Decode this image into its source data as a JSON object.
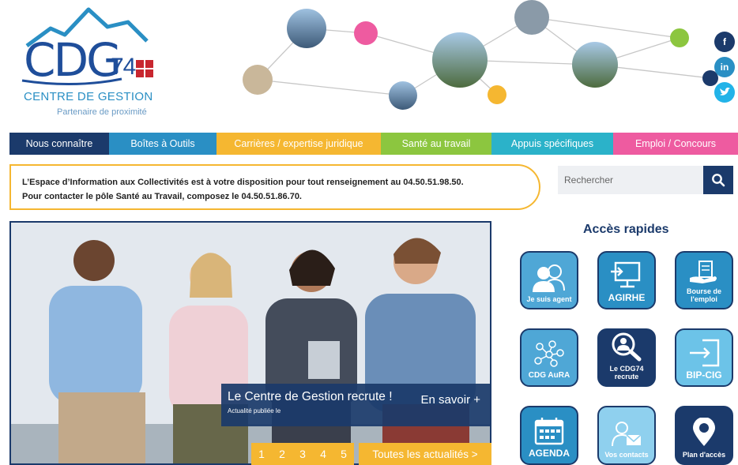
{
  "logo": {
    "main": "CDG",
    "number": "74",
    "subtitle": "CENTRE DE GESTION",
    "tagline": "Partenaire de proximité"
  },
  "social": [
    {
      "name": "facebook",
      "glyph": "f",
      "color": "#1b3a6b"
    },
    {
      "name": "linkedin",
      "glyph": "in",
      "color": "#2a8fc4"
    },
    {
      "name": "twitter",
      "glyph": "t",
      "color": "#22b3e8"
    }
  ],
  "nav": [
    {
      "label": "Nous connaître",
      "color": "#1b3a6b"
    },
    {
      "label": "Boîtes à Outils",
      "color": "#2a8fc4"
    },
    {
      "label": "Carrières / expertise juridique",
      "color": "#f5b731"
    },
    {
      "label": "Santé au travail",
      "color": "#8cc63f"
    },
    {
      "label": "Appuis spécifiques",
      "color": "#2bb2c9"
    },
    {
      "label": "Emploi / Concours",
      "color": "#ee5ba0"
    }
  ],
  "info": {
    "line1": "L’Espace d’Information aux Collectivités est à votre disposition pour tout renseignement au 04.50.51.98.50.",
    "line2": "Pour contacter le pôle Santé au Travail, composez le 04.50.51.86.70."
  },
  "search": {
    "placeholder": "Rechercher"
  },
  "hero": {
    "title": "Le Centre de Gestion recrute !",
    "more": "En savoir +",
    "meta": "Actualité publiée le",
    "pages": [
      "1",
      "2",
      "3",
      "4",
      "5"
    ],
    "all_news": "Toutes les actualités >"
  },
  "quick_access": {
    "title": "Accès rapides",
    "tiles": [
      {
        "label": "Je suis agent",
        "icon": "users-icon",
        "color": "#4fa7d6"
      },
      {
        "label": "AGIRHE",
        "icon": "computer-icon",
        "color": "#2a8fc4"
      },
      {
        "label": "Bourse de l'emploi",
        "icon": "hand-doc-icon",
        "color": "#2a8fc4"
      },
      {
        "label": "CDG AuRA",
        "icon": "network-icon",
        "color": "#4fa7d6"
      },
      {
        "label": "Le CDG74 recrute",
        "icon": "magnifier-person-icon",
        "color": "#1b3a6b"
      },
      {
        "label": "BIP-CIG",
        "icon": "login-icon",
        "color": "#6cc3e8"
      },
      {
        "label": "AGENDA",
        "icon": "calendar-icon",
        "color": "#2a8fc4"
      },
      {
        "label": "Vos contacts",
        "icon": "contact-mail-icon",
        "color": "#8fd0ee"
      },
      {
        "label": "Plan d'accès",
        "icon": "map-pin-icon",
        "color": "#1b3a6b"
      }
    ]
  }
}
